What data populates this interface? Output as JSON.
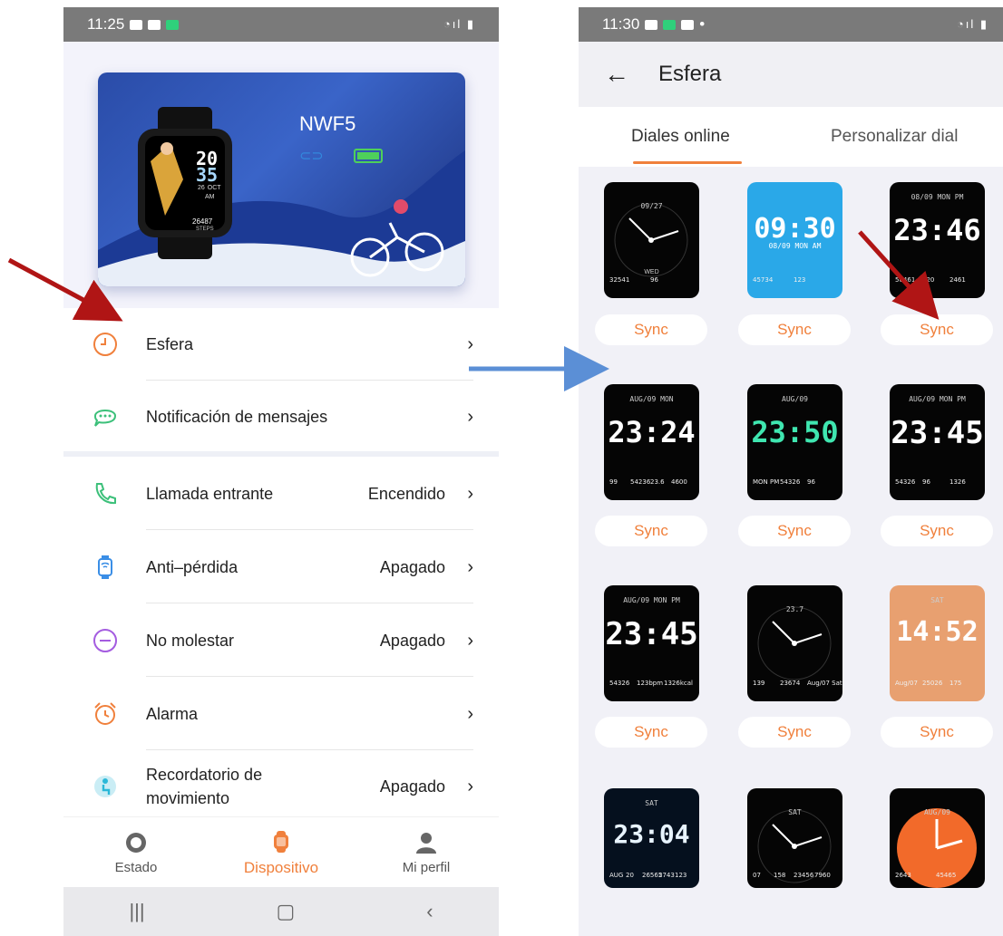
{
  "left_screen": {
    "status_time": "11:25",
    "device_model": "NWF5",
    "watch_face": {
      "hour": "20",
      "minute": "35",
      "day": "26",
      "month": "OCT",
      "ampm": "AM",
      "steps": "26487",
      "steps_label": "STEPS"
    },
    "menu": [
      {
        "label": "Esfera",
        "value": "",
        "icon": "clock-icon",
        "color": "#f0803c"
      },
      {
        "label": "Notificación de mensajes",
        "value": "",
        "icon": "chat-bubble-icon",
        "color": "#3cc07a"
      },
      {
        "label": "Llamada entrante",
        "value": "Encendido",
        "icon": "phone-icon",
        "color": "#3cc07a"
      },
      {
        "label": "Anti–pérdida",
        "value": "Apagado",
        "icon": "watch-signal-icon",
        "color": "#3a8ee6"
      },
      {
        "label": "No molestar",
        "value": "Apagado",
        "icon": "minus-circle-icon",
        "color": "#a45ce0"
      },
      {
        "label": "Alarma",
        "value": "",
        "icon": "alarm-clock-icon",
        "color": "#f0803c"
      },
      {
        "label": "Recordatorio de movimiento",
        "value": "Apagado",
        "icon": "sitting-person-icon",
        "color": "#2ab8d8"
      }
    ],
    "tabbar": [
      {
        "label": "Estado",
        "icon": "status-circle-icon",
        "active": false
      },
      {
        "label": "Dispositivo",
        "icon": "watch-icon",
        "active": true
      },
      {
        "label": "Mi perfil",
        "icon": "person-icon",
        "active": false
      }
    ]
  },
  "right_screen": {
    "status_time": "11:30",
    "title": "Esfera",
    "tabs": [
      "Diales online",
      "Personalizar dial"
    ],
    "sync_label": "Sync",
    "dials": [
      {
        "time": "",
        "sub": "09/27",
        "extra": "32541",
        "extra2": "96",
        "day": "WED"
      },
      {
        "time": "09:30",
        "sub": "08/09 MON AM",
        "extra": "45734",
        "extra2": "123"
      },
      {
        "time": "23:46",
        "sub": "08/09 MON PM",
        "extra": "56461",
        "extra2": "120",
        "extra3": "2461"
      },
      {
        "time": "23:24",
        "sub": "AUG/09 MON",
        "extra": "99",
        "extra2": "54236",
        "extra3": "23.6",
        "extra4": "4600"
      },
      {
        "time": "23:50",
        "sub": "AUG/09",
        "extra": "MON PM",
        "extra2": "54326",
        "extra3": "96"
      },
      {
        "time": "23:45",
        "sub": "AUG/09 MON PM",
        "extra": "54326",
        "extra2": "96",
        "extra3": "1326"
      },
      {
        "time": "23:45",
        "sub": "AUG/09 MON PM",
        "extra": "54326",
        "extra2": "123bpm",
        "extra3": "1326kcal"
      },
      {
        "time": "",
        "sub": "23.7",
        "extra": "139",
        "extra2": "23674",
        "extra3": "Aug/07 Sat"
      },
      {
        "time": "14:52",
        "sub": "SAT",
        "extra": "Aug/07",
        "extra2": "25026",
        "extra3": "175"
      },
      {
        "time": "23:04",
        "sub": "SAT",
        "extra": "AUG",
        "extra2": "20",
        "extra3": "26565",
        "extra4": "2743",
        "extra5": "123"
      },
      {
        "time": "",
        "sub": "SAT",
        "extra": "07",
        "extra2": "158",
        "extra3": "23456",
        "extra4": "7960"
      },
      {
        "time": "",
        "sub": "AUG/09",
        "extra": "2643",
        "extra2": "45465"
      }
    ]
  },
  "colors": {
    "accent": "#f0803c",
    "arrow_red": "#b01515",
    "arrow_blue": "#5b8fd6"
  }
}
